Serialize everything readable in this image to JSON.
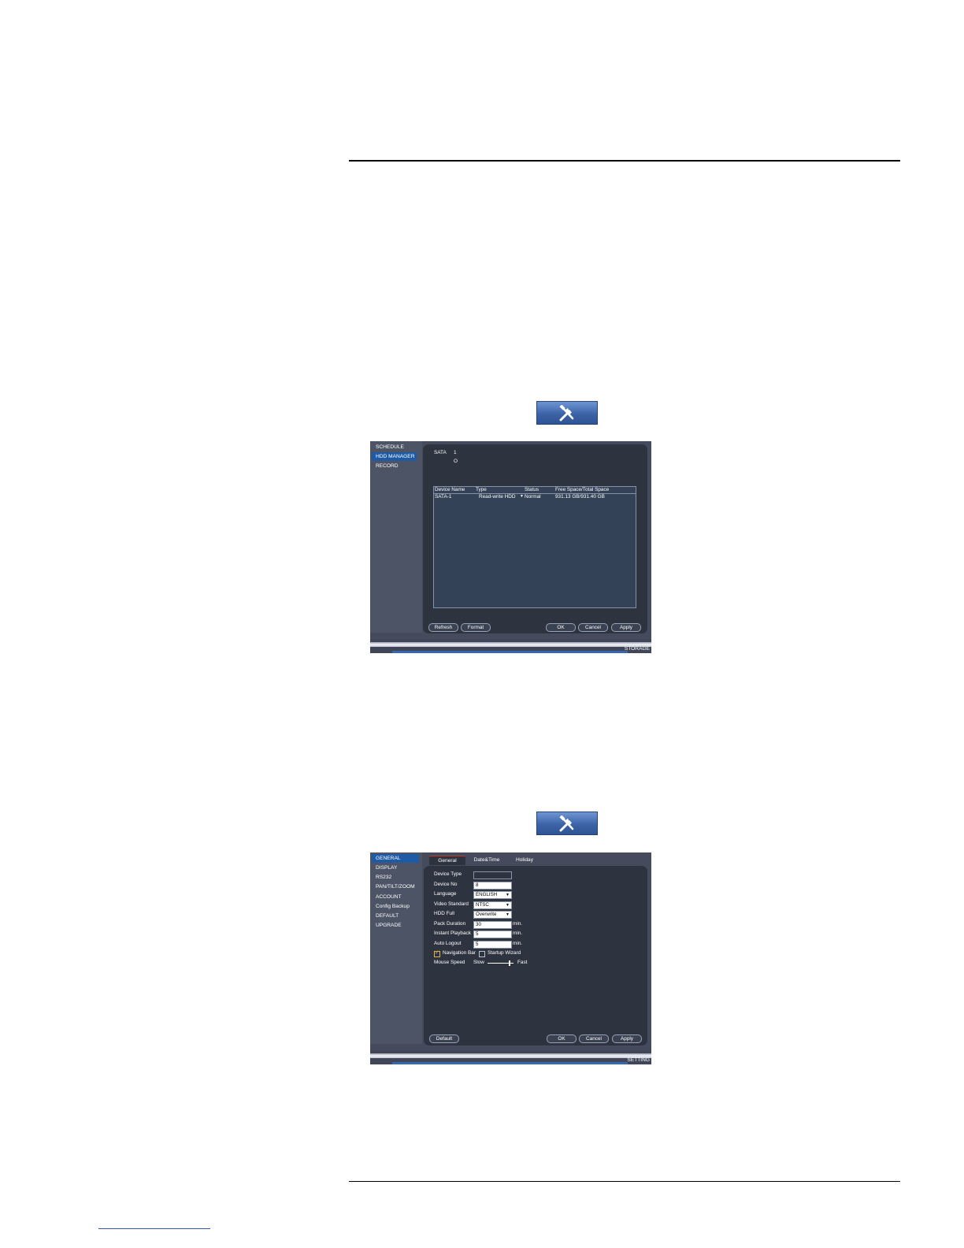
{
  "storage_screen": {
    "sidebar": [
      "SCHEDULE",
      "HDD MANAGER",
      "RECORD"
    ],
    "sata_label": "SATA",
    "sata_number": "1",
    "sata_indicator": "O",
    "table": {
      "headers": [
        "Device Name",
        "Type",
        "Status",
        "Free Space/Total Space"
      ],
      "rows": [
        {
          "device": "SATA-1",
          "type": "Read-write HDD",
          "status": "Normal",
          "space": "931.13 GB/931.40 GB"
        }
      ]
    },
    "buttons": {
      "refresh": "Refresh",
      "format": "Format",
      "ok": "OK",
      "cancel": "Cancel",
      "apply": "Apply"
    },
    "footer": "STORAGE"
  },
  "setting_screen": {
    "sidebar": [
      "GENERAL",
      "DISPLAY",
      "RS232",
      "PAN/TILT/ZOOM",
      "ACCOUNT",
      "Config Backup",
      "DEFAULT",
      "UPGRADE"
    ],
    "tabs": [
      "General",
      "Date&Time",
      "Holiday"
    ],
    "fields": {
      "device_type_label": "Device Type",
      "device_type_value": "",
      "device_no_label": "Device No",
      "device_no_value": "8",
      "language_label": "Language",
      "language_value": "ENGLISH",
      "video_standard_label": "Video Standard",
      "video_standard_value": "NTSC",
      "hdd_full_label": "HDD Full",
      "hdd_full_value": "Overwrite",
      "pack_duration_label": "Pack Duration",
      "pack_duration_value": "30",
      "instant_playback_label": "Instant Playback",
      "instant_playback_value": "5",
      "auto_logout_label": "Auto Logout",
      "auto_logout_value": "5",
      "unit_min": "min."
    },
    "checks": {
      "navigation_bar": {
        "label": "Navigation Bar",
        "checked": true
      },
      "startup_wizard": {
        "label": "Startup Wizard",
        "checked": false
      }
    },
    "mouse_speed": {
      "label": "Mouse Speed",
      "slow": "Slow",
      "fast": "Fast",
      "level": 0.85
    },
    "buttons": {
      "default": "Default",
      "ok": "OK",
      "cancel": "Cancel",
      "apply": "Apply"
    },
    "footer": "SETTING"
  },
  "colors": {
    "accent": "#1f5ba4",
    "panel": "#2d333f",
    "background": "#454b5c"
  }
}
